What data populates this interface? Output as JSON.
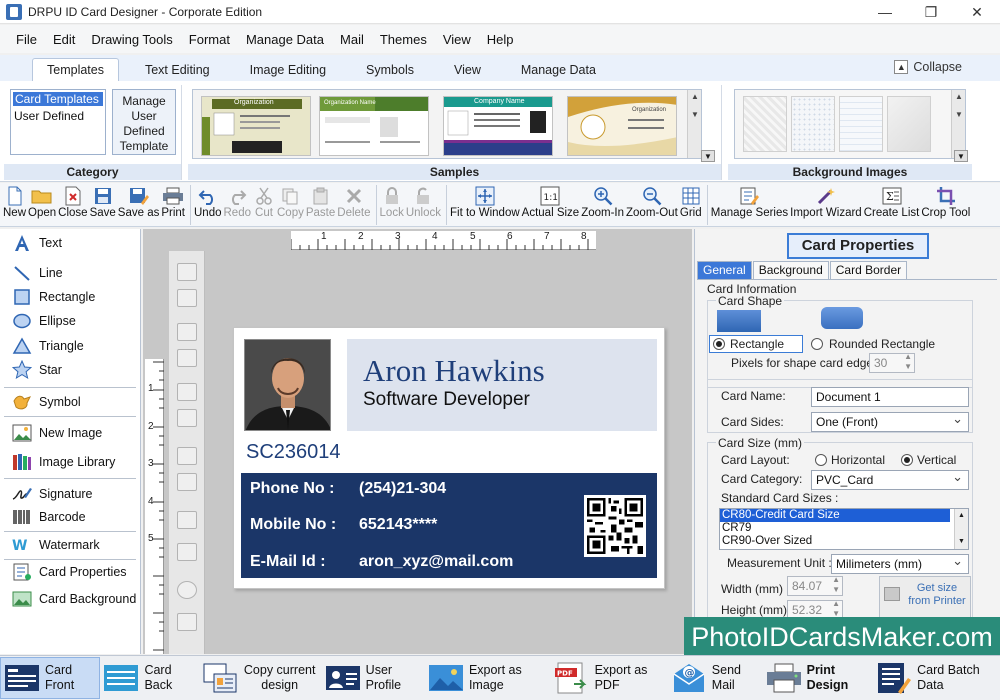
{
  "window": {
    "title": "DRPU ID Card Designer - Corporate Edition",
    "controls": [
      "—",
      "❐",
      "✕"
    ]
  },
  "menu": [
    "File",
    "Edit",
    "Drawing Tools",
    "Format",
    "Manage Data",
    "Mail",
    "Themes",
    "View",
    "Help"
  ],
  "ribbon_tabs": [
    "Templates",
    "Text Editing",
    "Image Editing",
    "Symbols",
    "View",
    "Manage Data"
  ],
  "collapse_label": "Collapse",
  "ribbon": {
    "category": {
      "label": "Category",
      "options": [
        "Card Templates",
        "User Defined"
      ],
      "manage_button": "Manage User Defined Template"
    },
    "samples": {
      "label": "Samples",
      "thumbs": [
        {
          "header": "Organization",
          "lines": [
            "Employee Name",
            "Position",
            "Unique No",
            "Member"
          ]
        },
        {
          "header": "Organization Name",
          "lines": [
            "IDENTIFICATION CARD",
            "Employee Name",
            "Date"
          ]
        },
        {
          "header": "Company Name",
          "lines": [
            "Employee Name",
            "Designation",
            "Email Id",
            "Address"
          ]
        },
        {
          "header": "Organization",
          "lines": [
            "Address",
            "Email Id",
            "Person Name"
          ]
        }
      ]
    },
    "background_images": {
      "label": "Background Images"
    }
  },
  "toolbar": [
    {
      "label": "New",
      "icon": "new-file-icon",
      "enabled": true
    },
    {
      "label": "Open",
      "icon": "open-folder-icon",
      "enabled": true
    },
    {
      "label": "Close",
      "icon": "close-file-icon",
      "enabled": true
    },
    {
      "label": "Save",
      "icon": "save-icon",
      "enabled": true
    },
    {
      "label": "Save as",
      "icon": "save-as-icon",
      "enabled": true
    },
    {
      "label": "Print",
      "icon": "print-icon",
      "enabled": true
    },
    {
      "label": "Undo",
      "icon": "undo-icon",
      "enabled": true
    },
    {
      "label": "Redo",
      "icon": "redo-icon",
      "enabled": false
    },
    {
      "label": "Cut",
      "icon": "cut-icon",
      "enabled": false
    },
    {
      "label": "Copy",
      "icon": "copy-icon",
      "enabled": false
    },
    {
      "label": "Paste",
      "icon": "paste-icon",
      "enabled": false
    },
    {
      "label": "Delete",
      "icon": "delete-icon",
      "enabled": false
    },
    {
      "label": "Lock",
      "icon": "lock-icon",
      "enabled": false
    },
    {
      "label": "Unlock",
      "icon": "unlock-icon",
      "enabled": false
    },
    {
      "label": "Fit to Window",
      "icon": "fit-window-icon",
      "enabled": true
    },
    {
      "label": "Actual Size",
      "icon": "actual-size-icon",
      "enabled": true
    },
    {
      "label": "Zoom-In",
      "icon": "zoom-in-icon",
      "enabled": true
    },
    {
      "label": "Zoom-Out",
      "icon": "zoom-out-icon",
      "enabled": true
    },
    {
      "label": "Grid",
      "icon": "grid-icon",
      "enabled": true
    },
    {
      "label": "Manage Series",
      "icon": "manage-series-icon",
      "enabled": true
    },
    {
      "label": "Import Wizard",
      "icon": "import-wizard-icon",
      "enabled": true
    },
    {
      "label": "Create List",
      "icon": "create-list-icon",
      "enabled": true
    },
    {
      "label": "Crop Tool",
      "icon": "crop-icon",
      "enabled": true
    }
  ],
  "left_tools": [
    {
      "label": "Text",
      "icon": "text-icon"
    },
    {
      "label": "Line",
      "icon": "line-icon"
    },
    {
      "label": "Rectangle",
      "icon": "rectangle-icon"
    },
    {
      "label": "Ellipse",
      "icon": "ellipse-icon"
    },
    {
      "label": "Triangle",
      "icon": "triangle-icon"
    },
    {
      "label": "Star",
      "icon": "star-icon"
    },
    {
      "label": "Symbol",
      "icon": "symbol-icon"
    },
    {
      "label": "New Image",
      "icon": "new-image-icon"
    },
    {
      "label": "Image Library",
      "icon": "image-library-icon"
    },
    {
      "label": "Signature",
      "icon": "signature-icon"
    },
    {
      "label": "Barcode",
      "icon": "barcode-icon"
    },
    {
      "label": "Watermark",
      "icon": "watermark-icon"
    },
    {
      "label": "Card Properties",
      "icon": "card-properties-icon"
    },
    {
      "label": "Card Background",
      "icon": "card-background-icon"
    }
  ],
  "rulers": {
    "top": [
      "1",
      "2",
      "3",
      "4",
      "5",
      "6",
      "7",
      "8"
    ],
    "left": [
      "1",
      "2",
      "3",
      "4",
      "5"
    ]
  },
  "card": {
    "name": "Aron Hawkins",
    "role": "Software Developer",
    "id": "SC236014",
    "fields": [
      {
        "label": "Phone No :",
        "value": "(254)21-304"
      },
      {
        "label": "Mobile No :",
        "value": "652143****"
      },
      {
        "label": "E-Mail Id :",
        "value": "aron_xyz@mail.com"
      }
    ],
    "colors": {
      "navy": "#1b3668",
      "name_blue": "#1f3f7a",
      "name_bg": "#dde3ee"
    }
  },
  "properties": {
    "title": "Card Properties",
    "tabs": [
      "General",
      "Background",
      "Card Border"
    ],
    "card_information": "Card Information",
    "card_shape": "Card Shape",
    "shape_rectangle": "Rectangle",
    "shape_rounded": "Rounded Rectangle",
    "pixels_label": "Pixels for shape card edge :",
    "pixels_value": "30",
    "card_name_label": "Card Name:",
    "card_name_value": "Document 1",
    "card_sides_label": "Card Sides:",
    "card_sides_value": "One (Front)",
    "card_size_label": "Card Size (mm)",
    "card_layout_label": "Card Layout:",
    "layout_horizontal": "Horizontal",
    "layout_vertical": "Vertical",
    "card_category_label": "Card Category:",
    "card_category_value": "PVC_Card",
    "standard_sizes_label": "Standard Card Sizes :",
    "standard_sizes": [
      "CR80-Credit Card Size",
      "CR79",
      "CR90-Over Sized"
    ],
    "measurement_label": "Measurement Unit :",
    "measurement_value": "Milimeters (mm)",
    "width_label": "Width  (mm)",
    "width_value": "84.07",
    "height_label": "Height  (mm)",
    "height_value": "52.32",
    "get_size_button": "Get size from Printer"
  },
  "watermark_text": "PhotoIDCardsMaker.com",
  "bottom_bar": [
    {
      "label": "Card Front",
      "icon": "card-front-icon",
      "active": true
    },
    {
      "label": "Card Back",
      "icon": "card-back-icon"
    },
    {
      "label": "Copy current design",
      "icon": "copy-design-icon"
    },
    {
      "label": "User Profile",
      "icon": "user-profile-icon"
    },
    {
      "label": "Export as Image",
      "icon": "export-image-icon"
    },
    {
      "label": "Export as PDF",
      "icon": "export-pdf-icon"
    },
    {
      "label": "Send Mail",
      "icon": "send-mail-icon"
    },
    {
      "label": "Print Design",
      "icon": "print-design-icon"
    },
    {
      "label": "Card Batch Data",
      "icon": "card-batch-data-icon"
    }
  ]
}
